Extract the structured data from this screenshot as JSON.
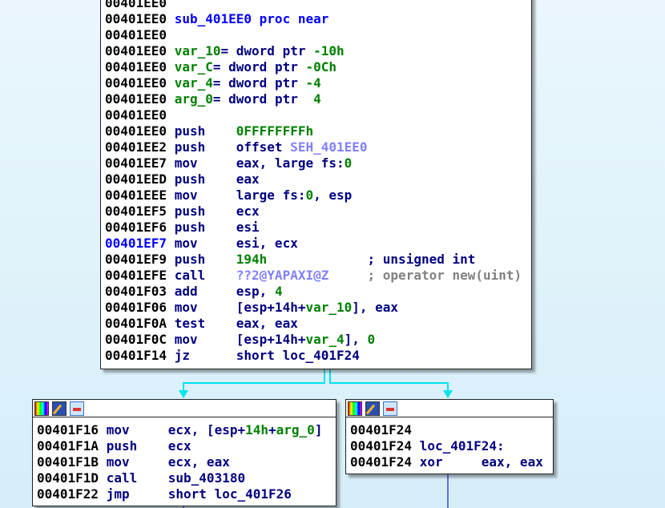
{
  "main_block": {
    "lines": [
      [
        [
          "00401EE0",
          "a"
        ]
      ],
      [
        [
          "00401EE0 ",
          "a"
        ],
        [
          "sub_401EE0 proc near",
          "f"
        ]
      ],
      [
        [
          "00401EE0",
          "a"
        ]
      ],
      [
        [
          "00401EE0 ",
          "a"
        ],
        [
          "var_10",
          "v"
        ],
        [
          "= dword ptr ",
          "o"
        ],
        [
          "-10h",
          "n"
        ]
      ],
      [
        [
          "00401EE0 ",
          "a"
        ],
        [
          "var_C",
          "v"
        ],
        [
          "= dword ptr ",
          "o"
        ],
        [
          "-0Ch",
          "n"
        ]
      ],
      [
        [
          "00401EE0 ",
          "a"
        ],
        [
          "var_4",
          "v"
        ],
        [
          "= dword ptr ",
          "o"
        ],
        [
          "-4",
          "n"
        ]
      ],
      [
        [
          "00401EE0 ",
          "a"
        ],
        [
          "arg_0",
          "v"
        ],
        [
          "= dword ptr  ",
          "o"
        ],
        [
          "4",
          "n"
        ]
      ],
      [
        [
          "00401EE0",
          "a"
        ]
      ],
      [
        [
          "00401EE0 ",
          "a"
        ],
        [
          "push    ",
          "m"
        ],
        [
          "0FFFFFFFFh",
          "n"
        ]
      ],
      [
        [
          "00401EE2 ",
          "a"
        ],
        [
          "push    ",
          "m"
        ],
        [
          "offset ",
          "o"
        ],
        [
          "SEH_401EE0",
          "s"
        ]
      ],
      [
        [
          "00401EE7 ",
          "a"
        ],
        [
          "mov     ",
          "m"
        ],
        [
          "eax, large fs:",
          "o"
        ],
        [
          "0",
          "n"
        ]
      ],
      [
        [
          "00401EED ",
          "a"
        ],
        [
          "push    ",
          "m"
        ],
        [
          "eax",
          "o"
        ]
      ],
      [
        [
          "00401EEE ",
          "a"
        ],
        [
          "mov     ",
          "m"
        ],
        [
          "large fs:",
          "o"
        ],
        [
          "0",
          "n"
        ],
        [
          ", esp",
          "o"
        ]
      ],
      [
        [
          "00401EF5 ",
          "a"
        ],
        [
          "push    ",
          "m"
        ],
        [
          "ecx",
          "o"
        ]
      ],
      [
        [
          "00401EF6 ",
          "a"
        ],
        [
          "push    ",
          "m"
        ],
        [
          "esi",
          "o"
        ]
      ],
      [
        [
          "00401EF7 ",
          "b"
        ],
        [
          "mov     ",
          "m"
        ],
        [
          "esi, ecx",
          "o"
        ]
      ],
      [
        [
          "00401EF9 ",
          "a"
        ],
        [
          "push    ",
          "m"
        ],
        [
          "194h",
          "n"
        ],
        [
          "             ; unsigned int",
          "o"
        ]
      ],
      [
        [
          "00401EFE ",
          "a"
        ],
        [
          "call    ",
          "m"
        ],
        [
          "??2@YAPAXI@Z",
          "s"
        ],
        [
          "     ; operator new(uint)",
          "c"
        ]
      ],
      [
        [
          "00401F03 ",
          "a"
        ],
        [
          "add     ",
          "m"
        ],
        [
          "esp, ",
          "o"
        ],
        [
          "4",
          "n"
        ]
      ],
      [
        [
          "00401F06 ",
          "a"
        ],
        [
          "mov     ",
          "m"
        ],
        [
          "[esp+14h+",
          "o"
        ],
        [
          "var_10",
          "v"
        ],
        [
          "], eax",
          "o"
        ]
      ],
      [
        [
          "00401F0A ",
          "a"
        ],
        [
          "test    ",
          "m"
        ],
        [
          "eax, eax",
          "o"
        ]
      ],
      [
        [
          "00401F0C ",
          "a"
        ],
        [
          "mov     ",
          "m"
        ],
        [
          "[esp+14h+",
          "o"
        ],
        [
          "var_4",
          "v"
        ],
        [
          "], ",
          "o"
        ],
        [
          "0",
          "n"
        ]
      ],
      [
        [
          "00401F14 ",
          "a"
        ],
        [
          "jz      ",
          "m"
        ],
        [
          "short loc_401F24",
          "o"
        ]
      ]
    ]
  },
  "left_block": {
    "lines": [
      [
        [
          "00401F16 ",
          "a"
        ],
        [
          "mov     ",
          "m"
        ],
        [
          "ecx, [esp+",
          "o"
        ],
        [
          "14h",
          "n"
        ],
        [
          "+",
          "o"
        ],
        [
          "arg_0",
          "v"
        ],
        [
          "]",
          "o"
        ]
      ],
      [
        [
          "00401F1A ",
          "a"
        ],
        [
          "push    ",
          "m"
        ],
        [
          "ecx",
          "o"
        ]
      ],
      [
        [
          "00401F1B ",
          "a"
        ],
        [
          "mov     ",
          "m"
        ],
        [
          "ecx, eax",
          "o"
        ]
      ],
      [
        [
          "00401F1D ",
          "a"
        ],
        [
          "call    ",
          "m"
        ],
        [
          "sub_403180",
          "o"
        ]
      ],
      [
        [
          "00401F22 ",
          "a"
        ],
        [
          "jmp     ",
          "m"
        ],
        [
          "short loc_401F26",
          "o"
        ]
      ]
    ]
  },
  "right_block": {
    "lines": [
      [
        [
          "00401F24",
          "a"
        ]
      ],
      [
        [
          "00401F24 ",
          "a"
        ],
        [
          "loc_401F24:",
          "o"
        ]
      ],
      [
        [
          "00401F24 ",
          "a"
        ],
        [
          "xor     ",
          "m"
        ],
        [
          "eax, eax",
          "o"
        ]
      ]
    ]
  },
  "header_icons": [
    "color-palette-icon",
    "edit-pencil-icon",
    "graph-overview-icon"
  ],
  "edge_colors": {
    "true_false": "#00e5ee",
    "flow": "#6070e0"
  }
}
